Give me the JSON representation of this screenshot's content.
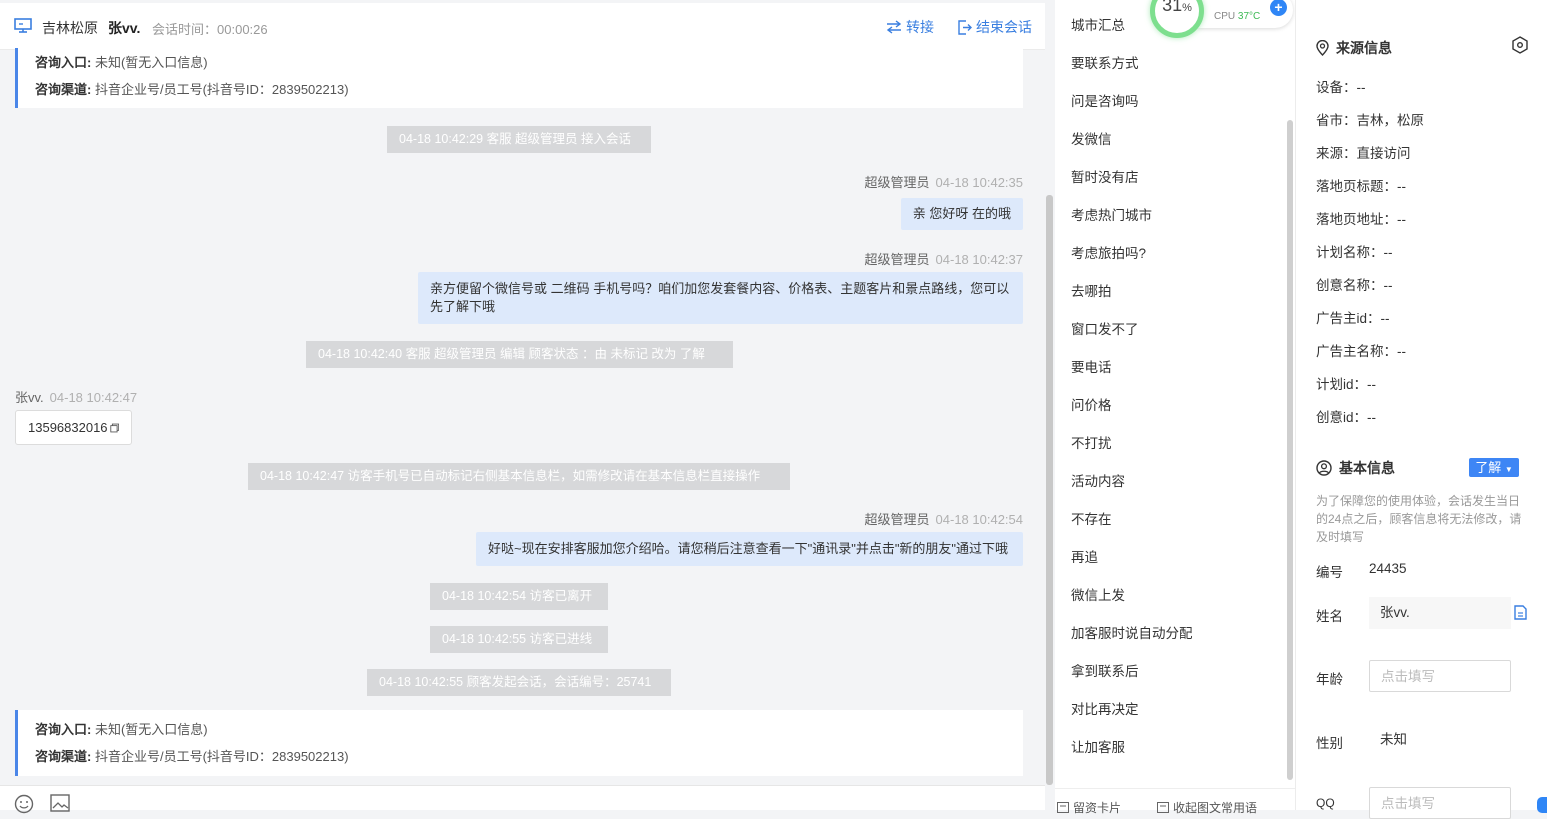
{
  "header": {
    "region": "吉林松原",
    "visitor_name": "张vv.",
    "duration_label": "会话时间：",
    "duration_value": "00:00:26",
    "transfer_label": "转接",
    "end_label": "结束会话"
  },
  "info_card": {
    "entry_label": "咨询入口:",
    "entry_value": "未知(暂无入口信息)",
    "channel_label": "咨询渠道:",
    "channel_value": "抖音企业号/员工号(抖音号ID：2839502213)"
  },
  "messages": {
    "sys1": "04-18 10:42:29 客服 超级管理员 接入会话",
    "m1_sender": "超级管理员",
    "m1_time": "04-18 10:42:35",
    "m1_text": "亲 您好呀 在的哦",
    "m2_sender": "超级管理员",
    "m2_time": "04-18 10:42:37",
    "m2_text": "亲方便留个微信号或 二维码 手机号吗？咱们加您发套餐内容、价格表、主题客片和景点路线，您可以先了解下哦",
    "sys2": "04-18 10:42:40 客服 超级管理员 编辑 顾客状态 ：由 未标记 改为 了解",
    "m3_sender": "张vv.",
    "m3_time": "04-18 10:42:47",
    "m3_text": "13596832016",
    "sys3": "04-18 10:42:47 访客手机号已自动标记右侧基本信息栏，如需修改请在基本信息栏直接操作",
    "m4_sender": "超级管理员",
    "m4_time": "04-18 10:42:54",
    "m4_text": "好哒~现在安排客服加您介绍哈。请您稍后注意查看一下\"通讯录\"并点击\"新的朋友\"通过下哦",
    "sys4": "04-18 10:42:54 访客已离开",
    "sys5": "04-18 10:42:55 访客已进线",
    "sys6": "04-18 10:42:55 顾客发起会话，会话编号：25741"
  },
  "quick_replies": [
    "城市汇总",
    "要联系方式",
    "问是咨询吗",
    "发微信",
    "暂时没有店",
    "考虑热门城市",
    "考虑旅拍吗?",
    "去哪拍",
    "窗口发不了",
    "要电话",
    "问价格",
    "不打扰",
    "活动内容",
    "不存在",
    "再追",
    "微信上发",
    "加客服时说自动分配",
    "拿到联系后",
    "对比再决定",
    "让加客服"
  ],
  "quick_footer": {
    "card_label": "留资卡片",
    "template_label": "收起图文常用语"
  },
  "cpu": {
    "percent": "31",
    "percent_sign": "%",
    "label": "CPU",
    "temp": "37°C"
  },
  "source_info": {
    "title": "来源信息",
    "rows": [
      "设备：--",
      "省市：吉林，松原",
      "来源：直接访问",
      "落地页标题：--",
      "落地页地址：--",
      "计划名称：--",
      "创意名称：--",
      "广告主id：--",
      "广告主名称：--",
      "计划id：--",
      "创意id：--"
    ]
  },
  "basic_info": {
    "title": "基本信息",
    "status_button": "了解",
    "notice": "为了保障您的使用体验，会话发生当日的24点之后，顾客信息将无法修改，请及时填写",
    "id_label": "编号",
    "id_value": "24435",
    "name_label": "姓名",
    "name_value": "张vv.",
    "age_label": "年龄",
    "age_placeholder": "点击填写",
    "gender_label": "性别",
    "gender_value": "未知",
    "qq_label": "QQ",
    "qq_placeholder": "点击填写"
  },
  "colors": {
    "accent": "#3a7fe0",
    "bubble_out": "#dde9fb",
    "sys_bg": "#d7d8da",
    "cpu_ring": "#7ddf8e"
  },
  "icons": [
    "monitor-icon",
    "transfer-icon",
    "exit-icon",
    "copy-icon",
    "location-icon",
    "eye-settings-icon",
    "user-circle-icon",
    "emoji-icon",
    "image-icon",
    "card-icon",
    "template-icon"
  ]
}
